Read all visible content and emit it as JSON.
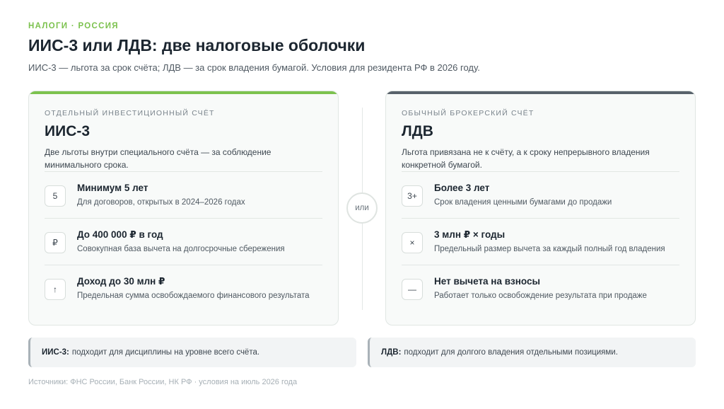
{
  "header": {
    "eyebrow": "НАЛОГИ · РОССИЯ",
    "title": "ИИС-3 или ЛДВ: две налоговые оболочки",
    "subtitle": "ИИС-3 — льгота за срок счёта; ЛДВ — за срок владения бумагой. Условия для резидента РФ в 2026 году."
  },
  "colors": {
    "accent_green": "#7cc24e",
    "accent_gray": "#58626b"
  },
  "left_card": {
    "kicker": "ОТДЕЛЬНЫЙ ИНВЕСТИЦИОННЫЙ СЧЁТ",
    "name": "ИИС-3",
    "desc": "Две льготы внутри специального счёта — за соблюдение минимального срока.",
    "items": [
      {
        "badge": "5",
        "title": "Минимум 5 лет",
        "text": "Для договоров, открытых в 2024–2026 годах"
      },
      {
        "badge": "₽",
        "title": "До 400 000 ₽ в год",
        "text": "Совокупная база вычета на долгосрочные сбережения"
      },
      {
        "badge": "↑",
        "title": "Доход до 30 млн ₽",
        "text": "Предельная сумма освобождаемого финансового результата"
      }
    ]
  },
  "divider": {
    "label": "или"
  },
  "right_card": {
    "kicker": "ОБЫЧНЫЙ БРОКЕРСКИЙ СЧЁТ",
    "name": "ЛДВ",
    "desc": "Льгота привязана не к счёту, а к сроку непрерывного владения конкретной бумагой.",
    "items": [
      {
        "badge": "3+",
        "title": "Более 3 лет",
        "text": "Срок владения ценными бумагами до продажи"
      },
      {
        "badge": "×",
        "title": "3 млн ₽ × годы",
        "text": "Предельный размер вычета за каждый полный год владения"
      },
      {
        "badge": "—",
        "title": "Нет вычета на взносы",
        "text": "Работает только освобождение результата при продаже"
      }
    ]
  },
  "notes": {
    "left": {
      "label": "ИИС-3:",
      "text": "подходит для дисциплины на уровне всего счёта."
    },
    "right": {
      "label": "ЛДВ:",
      "text": "подходит для долгого владения отдельными позициями."
    }
  },
  "footer": {
    "source": "Источники: ФНС России, Банк России, НК РФ · условия на июль 2026 года"
  }
}
